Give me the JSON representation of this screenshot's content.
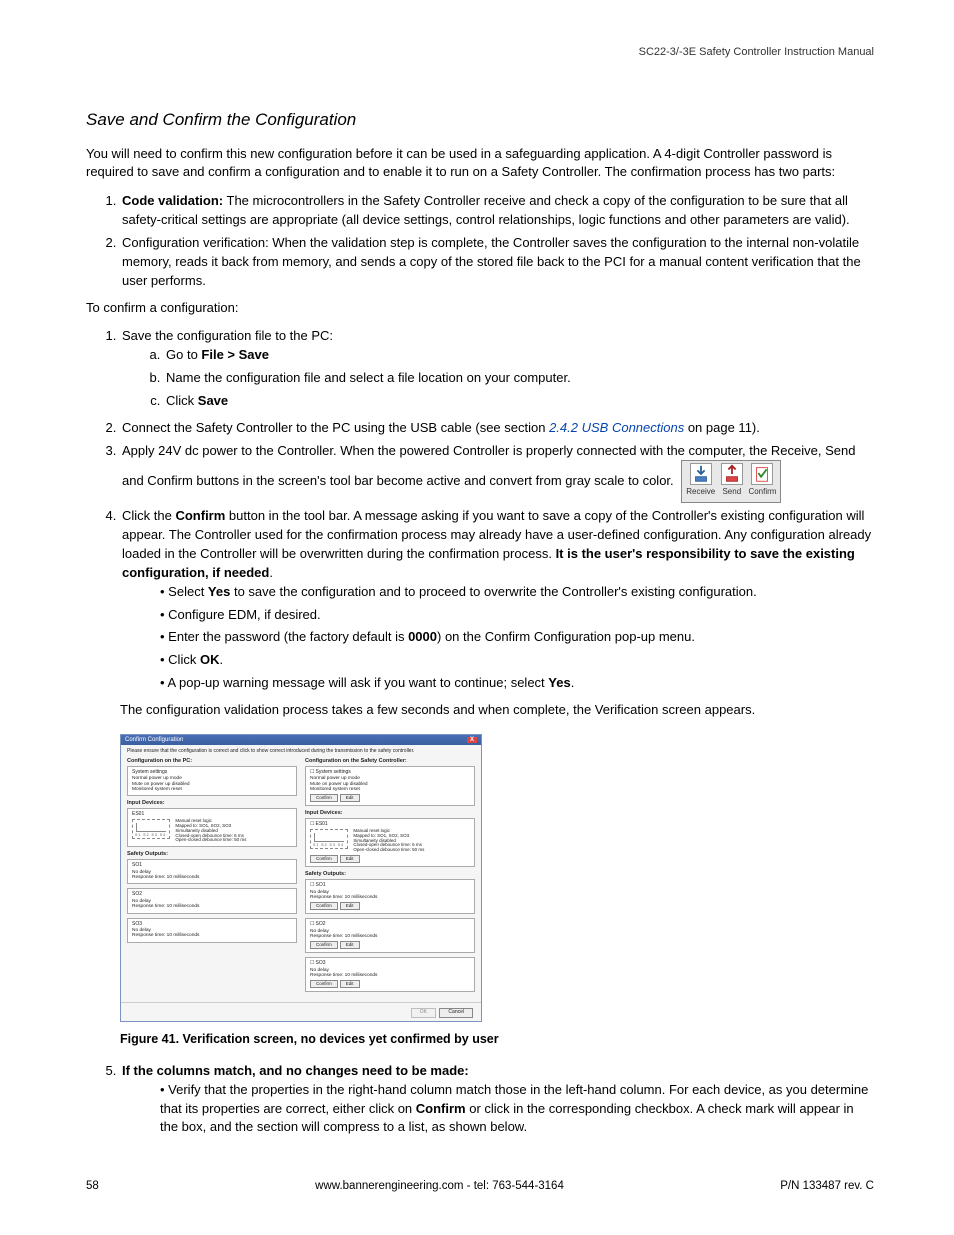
{
  "header": {
    "doc_title": "SC22-3/-3E Safety Controller Instruction Manual"
  },
  "title": "Save and Confirm the Configuration",
  "intro": "You will need to confirm this new configuration before it can be used in a safeguarding application. A 4-digit Controller password is required to save and confirm a configuration and to enable it to run on a Safety Controller. The confirmation process has two parts:",
  "parts": {
    "p1_lead": "Code validation:",
    "p1_rest": " The microcontrollers in the Safety Controller receive and check a copy of the configuration to be sure that all safety-critical settings are appropriate (all device settings, control relationships, logic functions and other parameters are valid).",
    "p2": "Configuration verification: When the validation step is complete, the Controller saves the configuration to the internal non-volatile memory, reads it back from memory, and sends a copy of the stored file back to the PCI for a manual content verification that the user performs."
  },
  "subhead": "To confirm a configuration:",
  "steps": {
    "s1": "Save the configuration file to the PC:",
    "s1a_pre": "Go to ",
    "s1a_bold": "File > Save",
    "s1b": "Name the configuration file and select a file location on your computer.",
    "s1c_pre": "Click ",
    "s1c_bold": "Save",
    "s2_pre": "Connect the Safety Controller to the PC using the USB cable (see section ",
    "s2_link": "2.4.2 USB Connections",
    "s2_post": " on page 11).",
    "s3_pre": "Apply 24V dc power to the Controller. When the powered Controller is properly connected with the computer, the Receive, Send and Confirm buttons in the screen's tool bar become active and convert from gray scale to color.",
    "toolbar": {
      "receive": "Receive",
      "send": "Send",
      "confirm": "Confirm"
    },
    "s4_pre": "Click the ",
    "s4_bold1": "Confirm",
    "s4_mid": " button in the tool bar. A message asking if you want to save a copy of the Controller's existing configuration will appear. The Controller used for the confirmation process may already have a user-defined configuration. Any configuration already loaded in the Controller will be overwritten during the confirmation process. ",
    "s4_bold2": "It is the user's responsibility to save the existing configuration, if needed",
    "s4_end": ".",
    "s4_b1_pre": "Select ",
    "s4_b1_bold": "Yes",
    "s4_b1_post": " to save the configuration and to proceed to overwrite the Controller's existing configuration.",
    "s4_b2": "Configure EDM, if desired.",
    "s4_b3_pre": "Enter the password (the factory default is ",
    "s4_b3_bold": "0000",
    "s4_b3_post": ") on the Confirm Configuration pop-up menu.",
    "s4_b4_pre": "Click ",
    "s4_b4_bold": "OK",
    "s4_b4_post": ".",
    "s4_b5_pre": "A pop-up warning message will ask if you want to continue; select ",
    "s4_b5_bold": "Yes",
    "s4_b5_post": "."
  },
  "post_steps": "The configuration validation process takes a few seconds and when complete, the Verification screen appears.",
  "dialog": {
    "title": "Confirm Configuration",
    "close": "X",
    "instr": "Please ensure that the configuration is correct and click to show correct introduced during the transmission to the safety controller.",
    "left_head": "Configuration on the PC:",
    "right_head": "Configuration on the Safety Controller:",
    "sys_title": "System settings",
    "sys_l1": "Normal power up mode",
    "sys_l2": "Mute on power up disabled",
    "sys_l3": "Monitored system reset",
    "input_head": "Input Devices:",
    "input_name": "ES01",
    "thumb_lbl": "S1  S2  S3  S4",
    "in_l1": "Manual reset logic",
    "in_l2": "Mapped to: SO1, SO2, SO3",
    "in_l3": "Simultaneity disabled",
    "in_l4": "Closed-open debounce time: 6 ms",
    "in_l5": "Open-closed debounce time: 50 ms",
    "out_head": "Safety Outputs:",
    "so1": "SO1",
    "so2": "SO2",
    "so3": "SO3",
    "so_l1": "No delay",
    "so_l2": "Response time: 10 milliseconds",
    "btn_confirm": "Confirm",
    "btn_edit": "Edit",
    "ok": "OK",
    "cancel": "Cancel"
  },
  "caption": "Figure 41. Verification screen, no devices yet confirmed by user",
  "step5": {
    "lead": "If the columns match, and no changes need to be made:",
    "b1_pre": "Verify that the properties in the right-hand column match those in the left-hand column. For each device, as you determine that its properties are correct, either click on ",
    "b1_bold": "Confirm",
    "b1_post": " or click in the corresponding checkbox. A check mark will appear in the box, and the section will compress to a list, as shown below."
  },
  "footer": {
    "page": "58",
    "center": "www.bannerengineering.com - tel: 763-544-3164",
    "right": "P/N 133487 rev. C"
  }
}
